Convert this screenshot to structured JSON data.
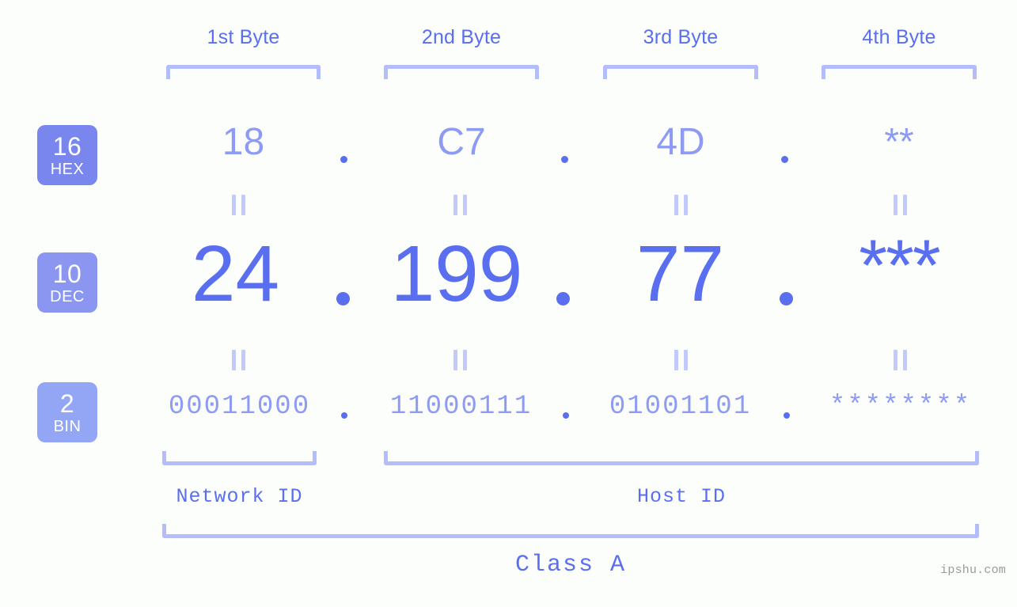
{
  "meta": {
    "background_color": "#fcfefb",
    "accent_color": "#5a6ff0",
    "accent_light_color": "#8e9bf3",
    "bracket_color": "#b3bdfb"
  },
  "byte_headers": [
    {
      "label": "1st Byte"
    },
    {
      "label": "2nd Byte"
    },
    {
      "label": "3rd Byte"
    },
    {
      "label": "4th Byte"
    }
  ],
  "bases": [
    {
      "number": "16",
      "abbr": "HEX",
      "color": "#7886ee"
    },
    {
      "number": "10",
      "abbr": "DEC",
      "color": "#8a96f0"
    },
    {
      "number": "2",
      "abbr": "BIN",
      "color": "#93a6f5"
    }
  ],
  "rows": {
    "hex": {
      "base_number": "16",
      "base_abbr": "HEX",
      "values": [
        "18",
        "C7",
        "4D",
        "**"
      ],
      "separator": "."
    },
    "dec": {
      "base_number": "10",
      "base_abbr": "DEC",
      "values": [
        "24",
        "199",
        "77",
        "***"
      ],
      "separator": "."
    },
    "bin": {
      "base_number": "2",
      "base_abbr": "BIN",
      "values": [
        "00011000",
        "11000111",
        "01001101",
        "********"
      ],
      "separator": "."
    }
  },
  "equality_marks": [
    "||",
    "||",
    "||",
    "||",
    "||",
    "||",
    "||",
    "||"
  ],
  "segments": {
    "network_id": "Network ID",
    "host_id": "Host ID",
    "class": "Class A"
  },
  "watermark": "ipshu.com"
}
